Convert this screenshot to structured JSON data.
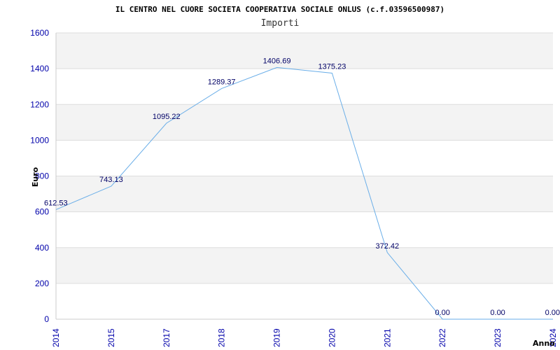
{
  "chart_data": {
    "type": "line",
    "title": "IL CENTRO NEL CUORE SOCIETA COOPERATIVA SOCIALE ONLUS (c.f.03596500987)",
    "subtitle": "Importi",
    "xlabel": "Anno",
    "ylabel": "Euro",
    "ylim": [
      0,
      1600
    ],
    "y_ticks": [
      0,
      200,
      400,
      600,
      800,
      1000,
      1200,
      1400,
      1600
    ],
    "grid": true,
    "x": [
      "2014",
      "2015",
      "2017",
      "2018",
      "2019",
      "2020",
      "2021",
      "2022",
      "2023",
      "2024"
    ],
    "series": [
      {
        "values": [
          612.53,
          743.13,
          1095.22,
          1289.37,
          1406.69,
          1375.23,
          372.42,
          0.0,
          0.0,
          0.0
        ],
        "labels": [
          "612.53",
          "743.13",
          "1095.22",
          "1289.37",
          "1406.69",
          "1375.23",
          "372.42",
          "0.00",
          "0.00",
          "0.00"
        ]
      }
    ],
    "colors": {
      "line": "#6aaee8",
      "band": "#f3f3f3",
      "grid": "#dddddd",
      "tick_text": "#0000aa",
      "label_text": "#000066"
    }
  }
}
